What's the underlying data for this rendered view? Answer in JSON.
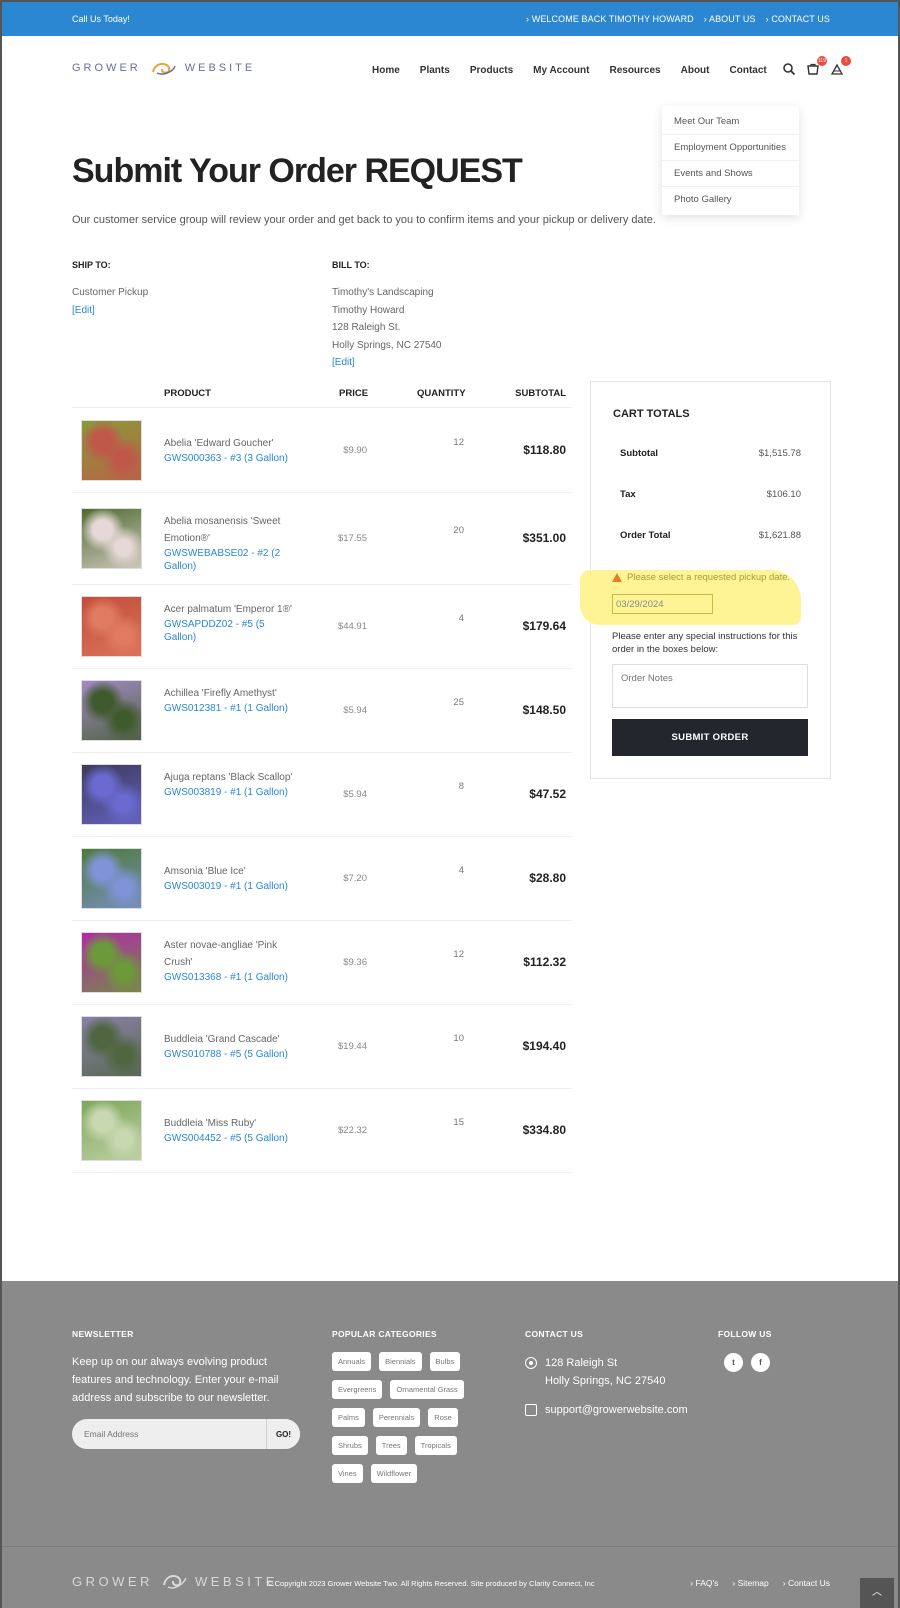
{
  "topbar": {
    "call": "Call Us Today!",
    "links": [
      "WELCOME BACK TIMOTHY HOWARD",
      "ABOUT US",
      "CONTACT US"
    ]
  },
  "header": {
    "logo_left": "GROWER",
    "logo_right": "WEBSITE",
    "nav": [
      "Home",
      "Plants",
      "Products",
      "My Account",
      "Resources",
      "About",
      "Contact"
    ],
    "cart_count": "119",
    "account_count": "1"
  },
  "about_menu": [
    "Meet Our Team",
    "Employment Opportunities",
    "Events and Shows",
    "Photo Gallery"
  ],
  "page": {
    "title": "Submit Your Order REQUEST",
    "intro": "Our customer service group will review your order and get back to you to confirm items and your pickup or delivery date."
  },
  "ship_to": {
    "label": "SHIP TO:",
    "lines": [
      "Customer Pickup"
    ],
    "edit": "[Edit]"
  },
  "bill_to": {
    "label": "BILL TO:",
    "lines": [
      "Timothy's Landscaping",
      "Timothy Howard",
      "128 Raleigh St.",
      "Holly Springs, NC 27540"
    ],
    "edit": "[Edit]"
  },
  "table": {
    "headers": {
      "product": "PRODUCT",
      "price": "PRICE",
      "quantity": "QUANTITY",
      "subtotal": "SUBTOTAL"
    },
    "rows": [
      {
        "name": "Abelia 'Edward Goucher'",
        "sku": "GWS000363 - #3 (3 Gallon)",
        "price": "$9.90",
        "qty": "12",
        "subtotal": "$118.80",
        "color1": "#8a9a3a",
        "color2": "#c0584a"
      },
      {
        "name": "Abelia mosanensis 'Sweet Emotion®'",
        "sku": "GWSWEBABSE02 - #2 (2 Gallon)",
        "price": "$17.55",
        "qty": "20",
        "subtotal": "$351.00",
        "color1": "#4f6b30",
        "color2": "#e6d8d6"
      },
      {
        "name": "Acer palmatum 'Emperor 1®'",
        "sku": "GWSAPDDZ02 - #5 (5 Gallon)",
        "price": "$44.91",
        "qty": "4",
        "subtotal": "$179.64",
        "color1": "#c24d3a",
        "color2": "#e07a60"
      },
      {
        "name": "Achillea 'Firefly Amethyst'",
        "sku": "GWS012381 - #1 (1 Gallon)",
        "price": "$5.94",
        "qty": "25",
        "subtotal": "$148.50",
        "color1": "#a48bc4",
        "color2": "#3f5a2c"
      },
      {
        "name": "Ajuga reptans 'Black Scallop'",
        "sku": "GWS003819 - #1 (1 Gallon)",
        "price": "$5.94",
        "qty": "8",
        "subtotal": "$47.52",
        "color1": "#3d3a5a",
        "color2": "#6a6ad0"
      },
      {
        "name": "Amsonia 'Blue Ice'",
        "sku": "GWS003019 - #1 (1 Gallon)",
        "price": "$7.20",
        "qty": "4",
        "subtotal": "$28.80",
        "color1": "#4c7a38",
        "color2": "#7f93d6"
      },
      {
        "name": "Aster novae-angliae 'Pink Crush'",
        "sku": "GWS013368 - #1 (1 Gallon)",
        "price": "$9.36",
        "qty": "12",
        "subtotal": "$112.32",
        "color1": "#b02aa6",
        "color2": "#6c9a3a"
      },
      {
        "name": "Buddleia 'Grand Cascade'",
        "sku": "GWS010788 - #5 (5 Gallon)",
        "price": "$19.44",
        "qty": "10",
        "subtotal": "$194.40",
        "color1": "#8a80a8",
        "color2": "#4f6640"
      },
      {
        "name": "Buddleia 'Miss Ruby'",
        "sku": "GWS004452 - #5 (5 Gallon)",
        "price": "$22.32",
        "qty": "15",
        "subtotal": "$334.80",
        "color1": "#7ea65a",
        "color2": "#c8d8b0"
      }
    ]
  },
  "cart_totals": {
    "title": "CART TOTALS",
    "subtotal_label": "Subtotal",
    "subtotal": "$1,515.78",
    "tax_label": "Tax",
    "tax": "$106.10",
    "total_label": "Order Total",
    "total": "$1,621.88",
    "warning": "Please select a requested pickup date.",
    "date_value": "03/29/2024",
    "instructions": "Please enter any special instructions for this order in the boxes below:",
    "notes_placeholder": "Order Notes",
    "submit": "SUBMIT ORDER"
  },
  "footer": {
    "newsletter_title": "NEWSLETTER",
    "newsletter_text": "Keep up on our always evolving product features and technology. Enter your e-mail address and subscribe to our newsletter.",
    "email_placeholder": "Email Address",
    "go": "GO!",
    "categories_title": "POPULAR CATEGORIES",
    "categories": [
      "Annuals",
      "Biennials",
      "Bulbs",
      "Evergreens",
      "Ornamental Grass",
      "Palms",
      "Perennials",
      "Rose",
      "Shrubs",
      "Trees",
      "Tropicals",
      "Vines",
      "Wildflower"
    ],
    "contact_title": "CONTACT US",
    "address_line1": "128 Raleigh St",
    "address_line2": "Holly Springs, NC 27540",
    "email": "support@growerwebsite.com",
    "follow_title": "FOLLOW US"
  },
  "bottom": {
    "logo_left": "GROWER",
    "logo_right": "WEBSITE",
    "copyright": "© Copyright 2023 Grower Website Two. All Rights Reserved. Site produced by Clarity Connect, Inc",
    "links": [
      "FAQ's",
      "Sitemap",
      "Contact Us"
    ]
  },
  "colors": {
    "primary": "#2b87d1",
    "dark": "#23272d",
    "footer": "#8a8a8a",
    "highlight": "#fff38a"
  }
}
